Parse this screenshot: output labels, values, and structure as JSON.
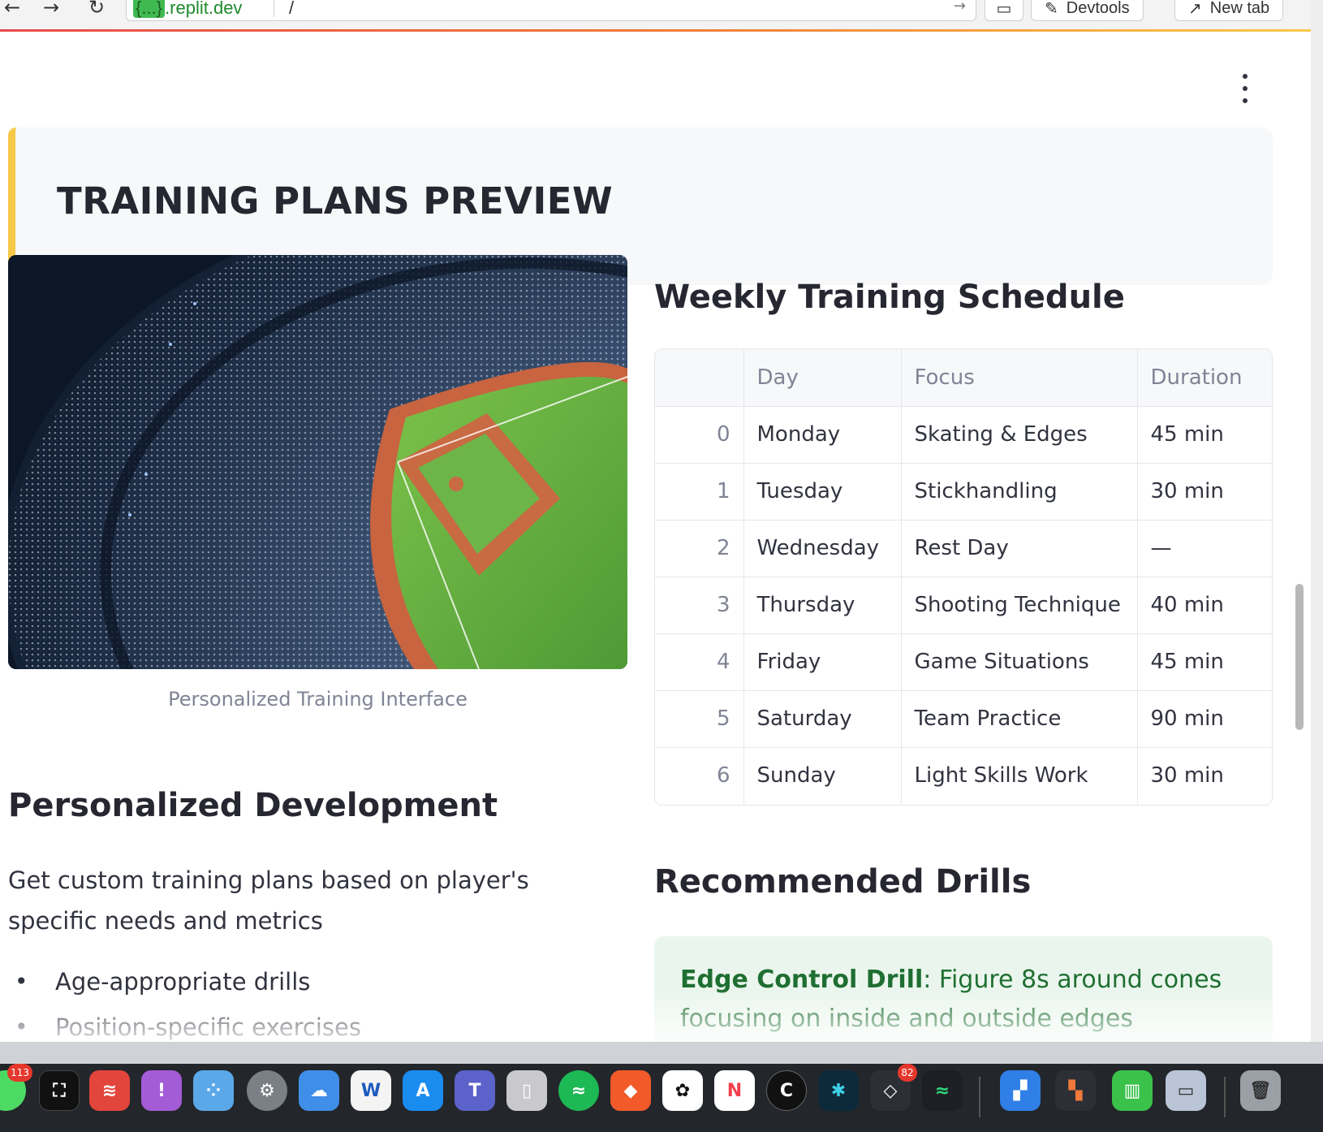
{
  "browser": {
    "back_icon": "arrow-left-icon",
    "forward_icon": "arrow-right-icon",
    "reload_icon": "reload-icon",
    "url_host_chip": "{...}",
    "url_host_rest": ".replit.dev",
    "url_path": "/",
    "devtools_label": "Devtools",
    "new_tab_label": "New tab"
  },
  "banner": {
    "title": "TRAINING PLANS PREVIEW",
    "accent_color": "#f7c948"
  },
  "image": {
    "caption": "Personalized Training Interface"
  },
  "development": {
    "heading": "Personalized Development",
    "text": "Get custom training plans based on player's specific needs and metrics",
    "bullets": [
      "Age-appropriate drills",
      "Position-specific exercises"
    ]
  },
  "schedule": {
    "heading": "Weekly Training Schedule",
    "columns": [
      "",
      "Day",
      "Focus",
      "Duration"
    ],
    "rows": [
      [
        "0",
        "Monday",
        "Skating & Edges",
        "45 min"
      ],
      [
        "1",
        "Tuesday",
        "Stickhandling",
        "30 min"
      ],
      [
        "2",
        "Wednesday",
        "Rest Day",
        "—"
      ],
      [
        "3",
        "Thursday",
        "Shooting Technique",
        "40 min"
      ],
      [
        "4",
        "Friday",
        "Game Situations",
        "45 min"
      ],
      [
        "5",
        "Saturday",
        "Team Practice",
        "90 min"
      ],
      [
        "6",
        "Sunday",
        "Light Skills Work",
        "30 min"
      ]
    ]
  },
  "drills": {
    "heading": "Recommended Drills",
    "first": {
      "name": "Edge Control Drill",
      "desc": ": Figure 8s around cones focusing on inside and outside edges"
    }
  },
  "dock": {
    "badges": {
      "messages": "113",
      "notes": "82"
    }
  }
}
